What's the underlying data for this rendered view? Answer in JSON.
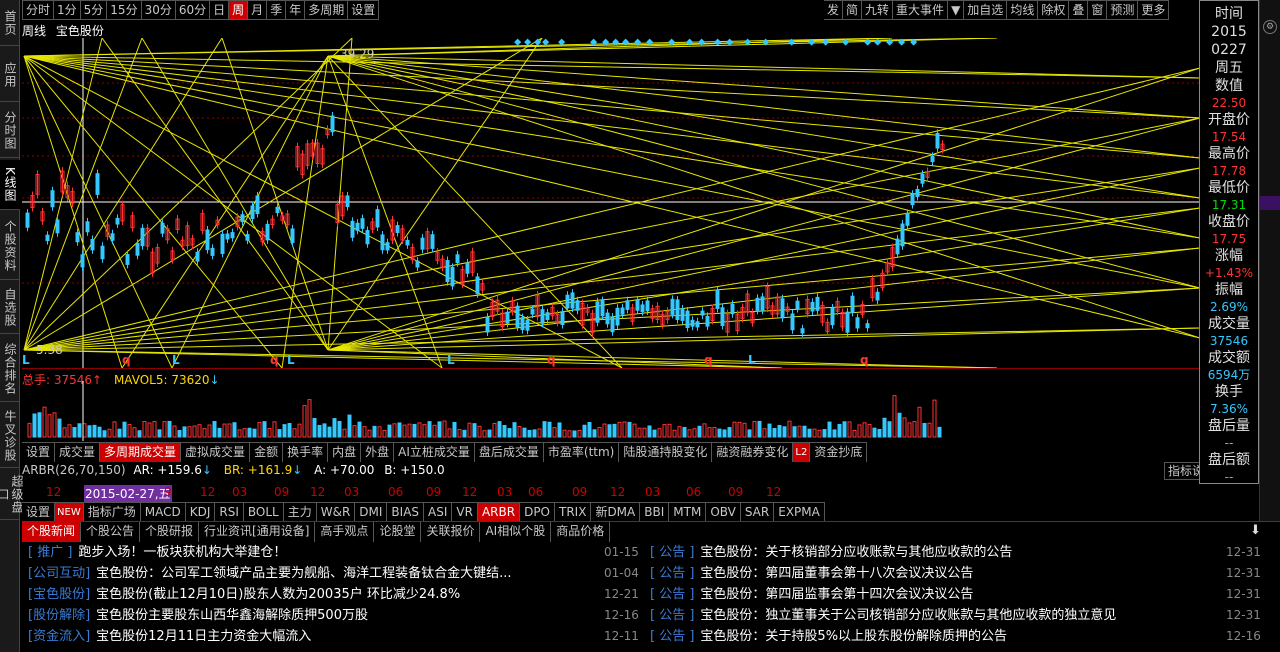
{
  "left_nav": [
    "首页",
    "应用",
    "分时图",
    "K线图",
    "个股资料",
    "自选股",
    "综合排名",
    "牛叉诊股",
    "超级盘口"
  ],
  "period_tabs": [
    "分时",
    "1分",
    "5分",
    "15分",
    "30分",
    "60分",
    "日",
    "周",
    "月",
    "季",
    "年",
    "多周期",
    "设置"
  ],
  "period_active": "周",
  "tools": [
    "发",
    "简",
    "九转",
    "重大事件",
    "▼",
    "加自选",
    "均线",
    "除权",
    "叠",
    "窗",
    "预测",
    "更多"
  ],
  "stock": {
    "period": "周线",
    "name": "宝色股份"
  },
  "chart_labels": {
    "high": "39.29",
    "low": "5.38"
  },
  "chart_marks": [
    "L",
    "q",
    "L",
    "q",
    "L",
    "L",
    "q",
    "q",
    "L",
    "q"
  ],
  "vol_line": {
    "total": "总手: 37546",
    "total_arrow": "↑",
    "ma": "MAVOL5: 73620",
    "ma_arrow": "↓"
  },
  "indicator_tabs1": [
    "设置",
    "成交量",
    "多周期成交量",
    "虚拟成交量",
    "金额",
    "换手率",
    "内盘",
    "外盘",
    "AI立桩成交量",
    "盘后成交量",
    "市盈率(ttm)",
    "陆股通持股变化",
    "融资融券变化",
    "L2",
    "资金抄底"
  ],
  "indicator_tabs1_active": "多周期成交量",
  "arbr": {
    "name": "ARBR(26,70,150)",
    "ar": "AR: +159.6",
    "ar_arrow": "↓",
    "br": "BR: +161.9",
    "br_arrow": "↓",
    "a": "A: +70.00",
    "b": "B: +150.0"
  },
  "indicator_btn": "指标说",
  "xaxis": [
    "12",
    "2015-02-27,五",
    "9",
    "12",
    "03",
    "09",
    "12",
    "03",
    "06",
    "09",
    "12",
    "03",
    "06",
    "09",
    "12",
    "03",
    "06",
    "09",
    "12"
  ],
  "indicator_tabs2": [
    "设置",
    "NEW",
    "指标广场",
    "MACD",
    "KDJ",
    "RSI",
    "BOLL",
    "主力",
    "W&R",
    "DMI",
    "BIAS",
    "ASI",
    "VR",
    "ARBR",
    "DPO",
    "TRIX",
    "新DMA",
    "BBI",
    "MTM",
    "OBV",
    "SAR",
    "EXPMA"
  ],
  "indicator_tabs2_active": "ARBR",
  "info": [
    {
      "label": "时间",
      "values": [
        "2015",
        "0227",
        "周五"
      ]
    },
    {
      "label": "数值",
      "value": "22.50",
      "color": "#ff3333"
    },
    {
      "label": "开盘价",
      "value": "17.54",
      "color": "#ff3333"
    },
    {
      "label": "最高价",
      "value": "17.78",
      "color": "#ff3333"
    },
    {
      "label": "最低价",
      "value": "17.31",
      "color": "#00e000"
    },
    {
      "label": "收盘价",
      "value": "17.75",
      "color": "#ff3333"
    },
    {
      "label": "涨幅",
      "value": "+1.43%",
      "color": "#ff3333"
    },
    {
      "label": "振幅",
      "value": "2.69%",
      "color": "#35c8ff"
    },
    {
      "label": "成交量",
      "value": "37546",
      "color": "#35c8ff"
    },
    {
      "label": "成交额",
      "value": "6594万",
      "color": "#35c8ff"
    },
    {
      "label": "换手",
      "value": "7.36%",
      "color": "#35c8ff"
    },
    {
      "label": "盘后量",
      "value": "--",
      "color": "#35c8ff"
    },
    {
      "label": "盘后额",
      "value": "--",
      "color": "#35c8ff"
    }
  ],
  "news_tabs": [
    "个股新闻",
    "个股公告",
    "个股研报",
    "行业资讯[通用设备]",
    "高手观点",
    "论股堂",
    "关联报价",
    "AI相似个股",
    "商品价格"
  ],
  "news_tabs_active": "个股新闻",
  "news_left": [
    {
      "tag": "[ 推广 ]",
      "title": "跑步入场！一板块获机构大举建仓！",
      "date": "01-15"
    },
    {
      "tag": "[公司互动]",
      "title": "宝色股份：公司军工领域产品主要为舰船、海洋工程装备钛合金大键结...",
      "date": "01-04"
    },
    {
      "tag": "[宝色股份]",
      "title": "宝色股份(截止12月10日)股东人数为20035户 环比减少24.8%",
      "date": "12-21"
    },
    {
      "tag": "[股份解除]",
      "title": "宝色股份主要股东山西华鑫海解除质押500万股",
      "date": "12-16"
    },
    {
      "tag": "[资金流入]",
      "title": "宝色股份12月11日主力资金大幅流入",
      "date": "12-11"
    }
  ],
  "news_right": [
    {
      "tag": "[ 公告 ]",
      "title": "宝色股份：关于核销部分应收账款与其他应收款的公告",
      "date": "12-31"
    },
    {
      "tag": "[ 公告 ]",
      "title": "宝色股份：第四届董事会第十八次会议决议公告",
      "date": "12-31"
    },
    {
      "tag": "[ 公告 ]",
      "title": "宝色股份：第四届监事会第十四次会议决议公告",
      "date": "12-31"
    },
    {
      "tag": "[ 公告 ]",
      "title": "宝色股份：独立董事关于公司核销部分应收账款与其他应收款的独立意见",
      "date": "12-31"
    },
    {
      "tag": "[ 公告 ]",
      "title": "宝色股份：关于持股5%以上股东股份解除质押的公告",
      "date": "12-16"
    }
  ]
}
